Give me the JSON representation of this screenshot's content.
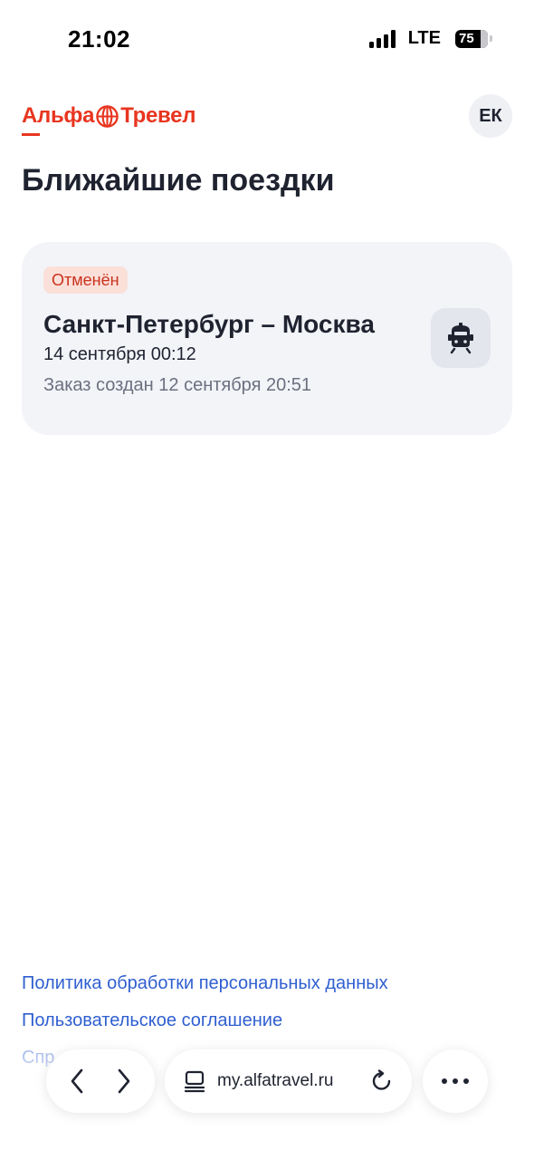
{
  "status_bar": {
    "time": "21:02",
    "network": "LTE",
    "battery": "75"
  },
  "header": {
    "logo_part1": "Альфа",
    "logo_part2": "Тревел",
    "avatar_initials": "ЕК",
    "brand_color": "#e8351f"
  },
  "page": {
    "title": "Ближайшие поездки"
  },
  "trips": [
    {
      "status": "Отменён",
      "route": "Санкт-Петербург – Москва",
      "departure": "14 сентября 00:12",
      "created": "Заказ создан 12 сентября 20:51",
      "icon": "train-icon"
    }
  ],
  "footer": {
    "privacy": "Политика обработки персональных данных",
    "agreement": "Пользовательское соглашение",
    "help": "Спр"
  },
  "browser": {
    "url": "my.alfatravel.ru",
    "icons": [
      "chevron-left-icon",
      "chevron-right-icon",
      "tabs-icon",
      "reload-icon",
      "more-icon"
    ]
  }
}
